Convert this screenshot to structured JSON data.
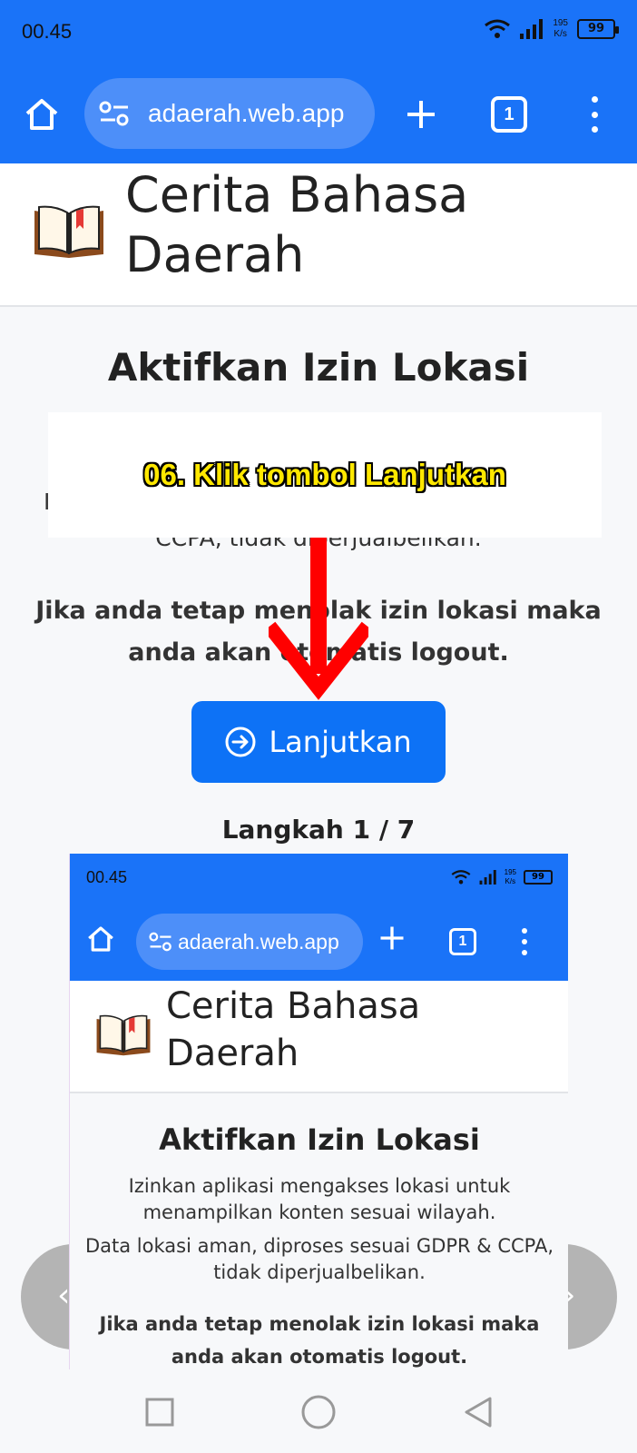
{
  "status_bar": {
    "time": "00.45",
    "speed_value": "195",
    "speed_unit": "K/s",
    "battery": "99"
  },
  "browser": {
    "url": "adaerah.web.app",
    "tab_count": "1"
  },
  "site": {
    "title": "Cerita Bahasa Daerah"
  },
  "main": {
    "heading": "Aktifkan Izin Lokasi",
    "partial_left": "I",
    "partial_text": "CCPA, tidak diperjualbelikan.",
    "warning": "Jika anda tetap menolak izin lokasi maka anda akan otomatis logout.",
    "continue_button": "Lanjutkan",
    "step": "Langkah 1 / 7"
  },
  "overlay": {
    "instruction": "06. Klik tombol Lanjutkan"
  },
  "embedded": {
    "time": "00.45",
    "speed_value": "195",
    "speed_unit": "K/s",
    "battery": "99",
    "url": "adaerah.web.app",
    "tab_count": "1",
    "title": "Cerita Bahasa Daerah",
    "heading": "Aktifkan Izin Lokasi",
    "p1": "Izinkan aplikasi mengakses lokasi untuk menampilkan konten sesuai wilayah.",
    "p2": "Data lokasi aman, diproses sesuai GDPR & CCPA, tidak diperjualbelikan.",
    "warning": "Jika anda tetap menolak izin lokasi maka anda akan otomatis logout."
  },
  "colors": {
    "browser_blue": "#1a73f8",
    "button_blue": "#0d72f6",
    "arrow_red": "#ff0000",
    "highlight_yellow": "#ffe800"
  }
}
